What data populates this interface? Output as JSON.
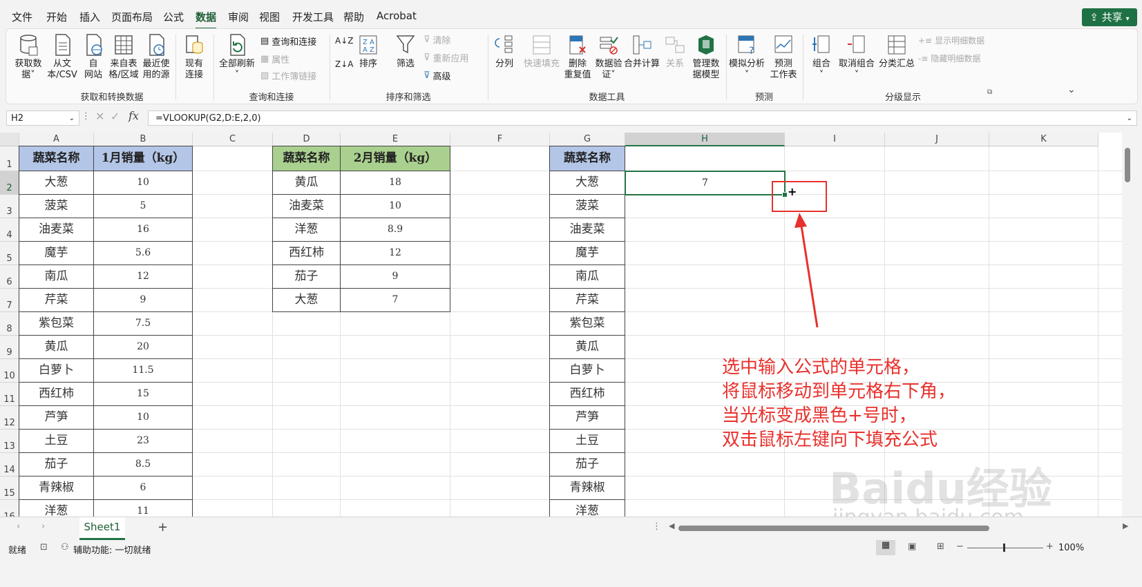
{
  "menu": {
    "items": [
      "文件",
      "开始",
      "插入",
      "页面布局",
      "公式",
      "数据",
      "审阅",
      "视图",
      "开发工具",
      "帮助",
      "Acrobat"
    ],
    "active": "数据",
    "share_label": "共享"
  },
  "ribbon": {
    "get_data": {
      "label": "获取数据",
      "sub": "据",
      "full1": "获取数",
      "full2": "据"
    },
    "from_text": {
      "l1": "从文",
      "l2": "本/CSV"
    },
    "from_web": {
      "l1": "自",
      "l2": "网站"
    },
    "from_table": {
      "l1": "来自表",
      "l2": "格/区域"
    },
    "recent": {
      "l1": "最近使",
      "l2": "用的源"
    },
    "existing": {
      "l1": "现有",
      "l2": "连接"
    },
    "refresh_all": {
      "l1": "全部刷新"
    },
    "queries": "查询和连接",
    "properties": "属性",
    "workbook_links": "工作簿链接",
    "sort": "排序",
    "filter": "筛选",
    "clear": "清除",
    "reapply": "重新应用",
    "advanced": "高级",
    "split": "分列",
    "flash_fill": "快速填充",
    "remove_dup": {
      "l1": "删除",
      "l2": "重复值"
    },
    "validation": {
      "l1": "数据验",
      "l2": "证"
    },
    "consolidate": "合并计算",
    "relations": "关系",
    "data_model": {
      "l1": "管理数",
      "l2": "据模型"
    },
    "what_if": {
      "l1": "模拟分析"
    },
    "forecast": {
      "l1": "预测",
      "l2": "工作表"
    },
    "group": "组合",
    "ungroup": "取消组合",
    "subtotal": "分类汇总",
    "show_detail": "显示明细数据",
    "hide_detail": "隐藏明细数据",
    "group_labels": [
      "获取和转换数据",
      "查询和连接",
      "排序和筛选",
      "数据工具",
      "预测",
      "分级显示"
    ]
  },
  "formula_bar": {
    "cell_ref": "H2",
    "formula": "=VLOOKUP(G2,D:E,2,0)"
  },
  "grid": {
    "columns": [
      "A",
      "B",
      "C",
      "D",
      "E",
      "F",
      "G",
      "H",
      "I",
      "J",
      "K"
    ],
    "rows": [
      "1",
      "2",
      "3",
      "4",
      "5",
      "6",
      "7",
      "8",
      "9",
      "10",
      "11",
      "12",
      "13",
      "14",
      "15",
      "16"
    ],
    "selected_col": "H",
    "selected_row": "2"
  },
  "table1": {
    "headers": [
      "蔬菜名称",
      "1月销量（kg）"
    ],
    "rows": [
      [
        "大葱",
        "10"
      ],
      [
        "菠菜",
        "5"
      ],
      [
        "油麦菜",
        "16"
      ],
      [
        "魔芋",
        "5.6"
      ],
      [
        "南瓜",
        "12"
      ],
      [
        "芹菜",
        "9"
      ],
      [
        "紫包菜",
        "7.5"
      ],
      [
        "黄瓜",
        "20"
      ],
      [
        "白萝卜",
        "11.5"
      ],
      [
        "西红柿",
        "15"
      ],
      [
        "芦笋",
        "10"
      ],
      [
        "土豆",
        "23"
      ],
      [
        "茄子",
        "8.5"
      ],
      [
        "青辣椒",
        "6"
      ],
      [
        "洋葱",
        "11"
      ]
    ]
  },
  "table2": {
    "headers": [
      "蔬菜名称",
      "2月销量（kg）"
    ],
    "rows": [
      [
        "黄瓜",
        "18"
      ],
      [
        "油麦菜",
        "10"
      ],
      [
        "洋葱",
        "8.9"
      ],
      [
        "西红柿",
        "12"
      ],
      [
        "茄子",
        "9"
      ],
      [
        "大葱",
        "7"
      ]
    ]
  },
  "table3": {
    "header": "蔬菜名称",
    "rows": [
      "大葱",
      "菠菜",
      "油麦菜",
      "魔芋",
      "南瓜",
      "芹菜",
      "紫包菜",
      "黄瓜",
      "白萝卜",
      "西红柿",
      "芦笋",
      "土豆",
      "茄子",
      "青辣椒",
      "洋葱"
    ],
    "h2_value": "7"
  },
  "annotation": {
    "lines": [
      "选中输入公式的单元格，",
      "将鼠标移动到单元格右下角，",
      "当光标变成黑色+号时，",
      "双击鼠标左键向下填充公式"
    ],
    "color": "#e8302c"
  },
  "watermark": {
    "logo": "Baidu经验",
    "url": "jingyan.baidu.com"
  },
  "tabs": {
    "sheet": "Sheet1",
    "add": "+"
  },
  "status": {
    "ready": "就绪",
    "accessibility": "辅助功能: 一切就绪",
    "zoom": "100%"
  }
}
